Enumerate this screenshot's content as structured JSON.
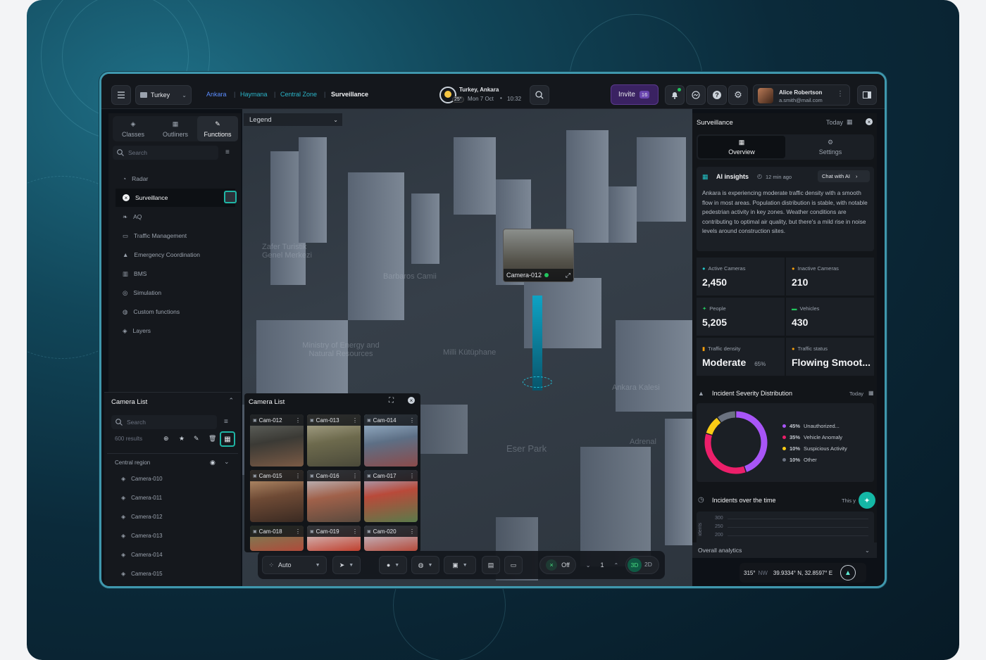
{
  "topbar": {
    "country": "Turkey",
    "breadcrumb": [
      "Ankara",
      "Haymana",
      "Central Zone",
      "Surveillance"
    ],
    "weather": {
      "location": "Turkey, Ankara",
      "temp": "25°",
      "date": "Mon 7 Oct",
      "time": "10:32"
    },
    "invite_label": "Invite",
    "invite_count": "16",
    "user": {
      "name": "Alice Robertson",
      "email": "a.smith@mail.com"
    }
  },
  "sidebar": {
    "tabs": [
      "Classes",
      "Outliners",
      "Functions"
    ],
    "search_placeholder": "Search",
    "items": [
      "Radar",
      "Surveillance",
      "AQ",
      "Traffic Management",
      "Emergency Coordination",
      "BMS",
      "Simulation",
      "Custom functions",
      "Layers"
    ]
  },
  "camera_list_panel": {
    "title": "Camera List",
    "search_placeholder": "Search",
    "results": "600 results",
    "region": "Central region",
    "cameras": [
      "Camera-010",
      "Camera-011",
      "Camera-012",
      "Camera-013",
      "Camera-014",
      "Camera-015"
    ]
  },
  "camera_grid": {
    "title": "Camera List",
    "cams": [
      "Cam-012",
      "Cam-013",
      "Cam-014",
      "Cam-015",
      "Cam-016",
      "Cam-017",
      "Cam-018",
      "Cam-019",
      "Cam-020"
    ]
  },
  "map": {
    "legend": "Legend",
    "popup_camera": "Camera-012",
    "labels": [
      "Barbaros Camii",
      "Ministry of Energy and Natural Resources",
      "Milli Kütüphane",
      "Eser Park",
      "Zafer Turistik Genel Merkezi",
      "Ankara Kalesi",
      "Adrenal"
    ],
    "coords": {
      "heading": "315°",
      "dir": "NW",
      "latlon": "39.9334° N, 32.8597° E"
    }
  },
  "toolbar": {
    "auto_label": "Auto",
    "off_label": "Off",
    "floor": "1",
    "mode_3d": "3D",
    "mode_2d": "2D"
  },
  "right_panel": {
    "title": "Surveillance",
    "date_filter": "Today",
    "tabs": [
      "Overview",
      "Settings"
    ],
    "ai": {
      "title": "AI insights",
      "time": "12 min ago",
      "chat_label": "Chat with AI",
      "text": "Ankara is experiencing moderate traffic density with a smooth flow in most areas. Population distribution is stable, with notable pedestrian activity in key zones. Weather conditions are contributing to optimal air quality, but there's a mild rise in noise levels around construction sites."
    },
    "stats": [
      {
        "label": "Active Cameras",
        "value": "2,450",
        "color": "#22c5c8"
      },
      {
        "label": "Inactive Cameras",
        "value": "210",
        "color": "#f59e0b"
      },
      {
        "label": "People",
        "value": "5,205",
        "color": "#22c55e"
      },
      {
        "label": "Vehicles",
        "value": "430",
        "color": "#22c55e"
      },
      {
        "label": "Traffic density",
        "value": "Moderate",
        "sub": "65%",
        "color": "#f59e0b"
      },
      {
        "label": "Traffic status",
        "value": "Flowing Smoot...",
        "color": "#f59e0b"
      }
    ],
    "incident": {
      "title": "Incident Severity Distribution",
      "filter": "Today",
      "items": [
        {
          "pct": "45%",
          "label": "Unauthorized...",
          "color": "#a855f7",
          "value": 45
        },
        {
          "pct": "35%",
          "label": "Vehicle Anomaly",
          "color": "#ec1f6a",
          "value": 35
        },
        {
          "pct": "10%",
          "label": "Suspicious Activity",
          "color": "#facc15",
          "value": 10
        },
        {
          "pct": "10%",
          "label": "Other",
          "color": "#6b7280",
          "value": 10
        }
      ]
    },
    "over_time": {
      "title": "Incidents over the time",
      "filter": "This y",
      "ylabel": "idents",
      "ticks": [
        "300",
        "250",
        "200"
      ]
    },
    "analytics_label": "Overall analytics"
  }
}
